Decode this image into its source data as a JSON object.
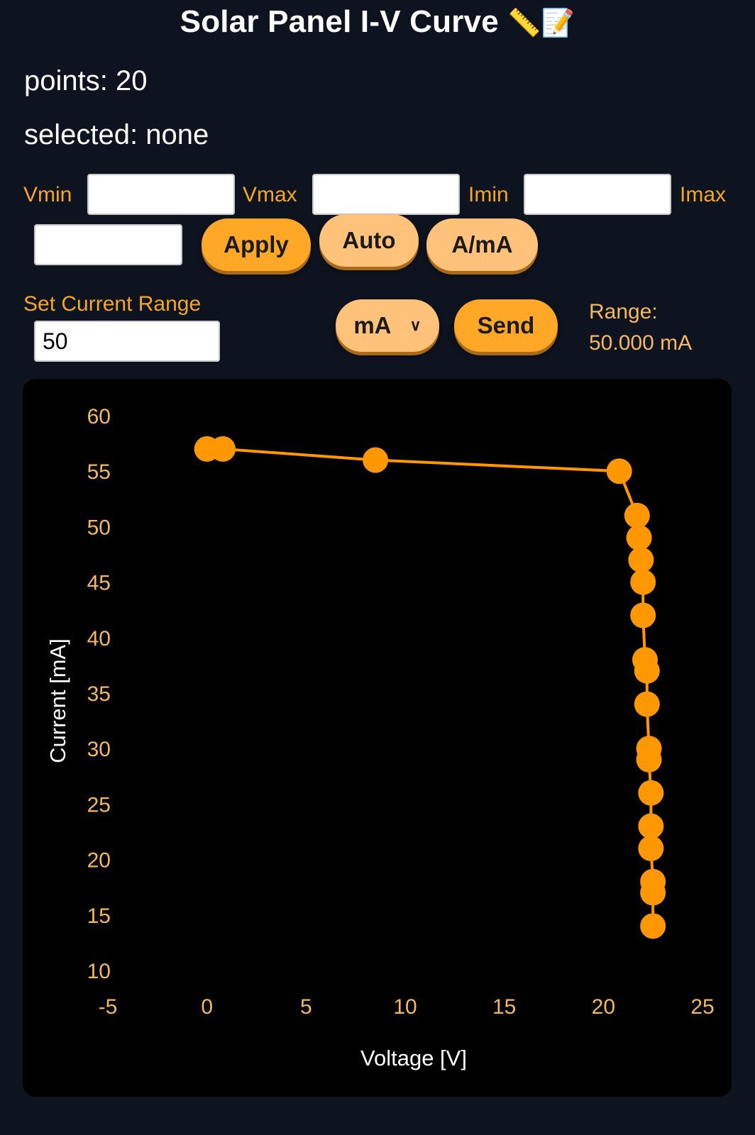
{
  "header": {
    "title": "Solar Panel I-V Curve",
    "title_emoji": "📏📝"
  },
  "status": {
    "points": "points: 20",
    "selected": "selected: none"
  },
  "limits": {
    "vmin_label": "Vmin",
    "vmin_value": "",
    "vmax_label": "Vmax",
    "vmax_value": "",
    "imin_label": "Imin",
    "imin_value": "",
    "imax_label": "Imax",
    "imax_value": ""
  },
  "buttons": {
    "apply": "Apply",
    "auto": "Auto",
    "unit_toggle": "A/mA",
    "send": "Send"
  },
  "current_range": {
    "label": "Set Current Range",
    "value": "50",
    "unit_selected": "mA",
    "range_label": "Range:",
    "range_value": "50.000 mA"
  },
  "colors": {
    "accent": "#ffa726",
    "background": "#0e1320",
    "chart_background": "#000000",
    "series": "#ff9800"
  },
  "icons": [
    "chevron-down-icon",
    "ruler-emoji",
    "memo-emoji"
  ],
  "chart_data": {
    "type": "scatter",
    "xlabel": "Voltage [V]",
    "ylabel": "Current [mA]",
    "xlim": [
      -5,
      25
    ],
    "ylim": [
      10,
      60
    ],
    "xticks": [
      "-5",
      "0",
      "5",
      "10",
      "15",
      "20",
      "25"
    ],
    "yticks": [
      "60",
      "55",
      "50",
      "45",
      "40",
      "35",
      "30",
      "25",
      "20",
      "15",
      "10"
    ],
    "grid": false,
    "connected": true,
    "series": [
      {
        "x": [
          0.0,
          0.8,
          8.5,
          20.8,
          21.7,
          21.8,
          21.9,
          22.0,
          22.0,
          22.1,
          22.2,
          22.2,
          22.3,
          22.3,
          22.4,
          22.4,
          22.4,
          22.5,
          22.5,
          22.5
        ],
        "y": [
          57.0,
          57.0,
          56.0,
          55.0,
          51.0,
          49.0,
          47.0,
          45.0,
          42.0,
          38.0,
          37.0,
          34.0,
          30.0,
          29.0,
          26.0,
          23.0,
          21.0,
          18.0,
          17.0,
          14.0
        ]
      }
    ]
  }
}
